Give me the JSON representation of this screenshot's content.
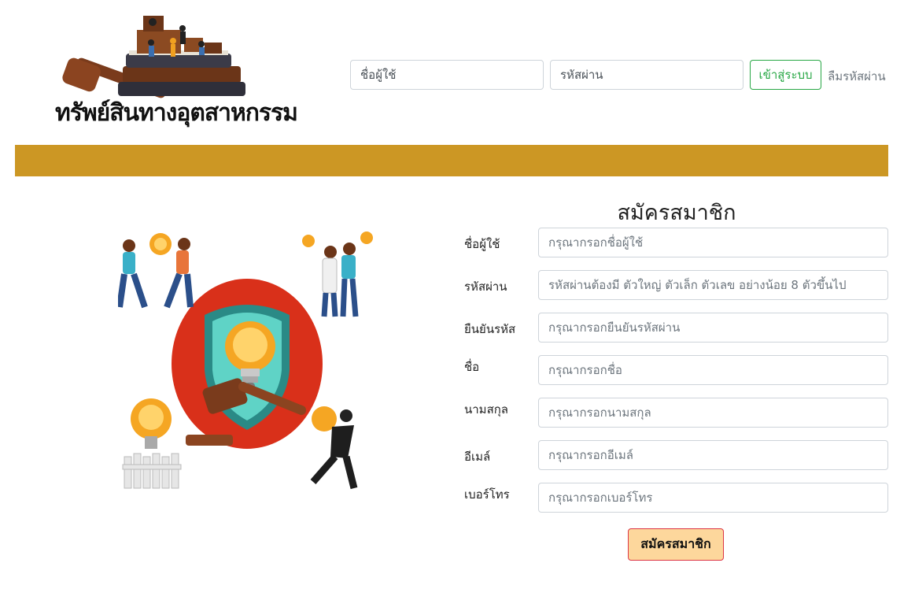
{
  "header": {
    "logo_text": "ทรัพย์สินทางอุตสาหกรรม",
    "username_placeholder": "ชื่อผู้ใช้",
    "password_placeholder": "รหัสผ่าน",
    "login_label": "เข้าสู่ระบบ",
    "forgot_label": "ลืมรหัสผ่าน"
  },
  "colors": {
    "banner": "#cc9724",
    "login_button": "#28a745",
    "submit_bg": "#fdd79c",
    "submit_border": "#dc3545"
  },
  "form": {
    "title": "สมัครสมาชิก",
    "fields": [
      {
        "label": "ชื่อผู้ใช้",
        "placeholder": "กรุณากรอกชื่อผู้ใช้"
      },
      {
        "label": "รหัสผ่าน",
        "placeholder": "รหัสผ่านต้องมี ตัวใหญ่ ตัวเล็ก ตัวเลข อย่างน้อย 8 ตัวขึ้นไป"
      },
      {
        "label": "ยืนยันรหัส",
        "placeholder": "กรุณากรอกยืนยันรหัสผ่าน"
      },
      {
        "label": "ชื่อ",
        "placeholder": "กรุณากรอกชื่อ"
      },
      {
        "label": "นามสกุล",
        "placeholder": "กรุณากรอกนามสกุล"
      },
      {
        "label": "อีเมล์",
        "placeholder": "กรุณากรอกอีเมล์"
      },
      {
        "label": "เบอร์โทร",
        "placeholder": "กรุณากรอกเบอร์โทร"
      }
    ],
    "submit_label": "สมัครสมาชิก"
  },
  "icons": [
    "courtroom-logo-image",
    "intellectual-property-illustration"
  ]
}
